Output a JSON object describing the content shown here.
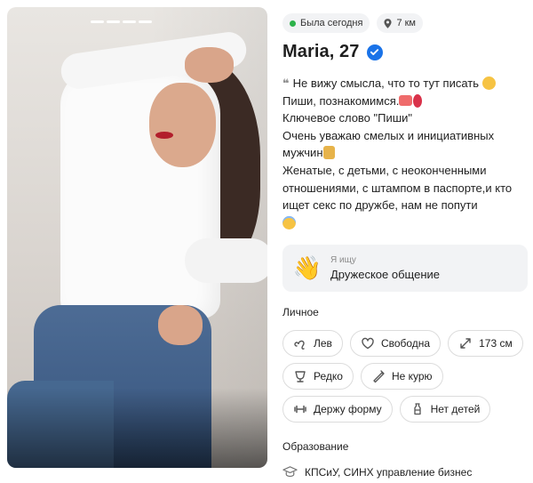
{
  "photo": {
    "story_bars": 4,
    "alt": "profile-photo"
  },
  "status": {
    "online_label": "Была сегодня",
    "distance_label": "7 км"
  },
  "profile": {
    "name_age": "Maria, 27",
    "verified": true
  },
  "bio": {
    "line1": "Не вижу смысла, что то тут писать",
    "line2": "Пиши, познакомимся.",
    "line3": "Ключевое слово \"Пиши\"",
    "line4": "Очень уважаю смелых и инициативных мужчин",
    "line5": "Женатые, с детьми, с неоконченными отношениями, с штампом в паспорте,и кто ищет секс по дружбе, нам не попути"
  },
  "seeking": {
    "label": "Я ищу",
    "value": "Дружеское общение"
  },
  "personal": {
    "title": "Личное",
    "tags": [
      {
        "icon": "leo-zodiac-icon",
        "label": "Лев"
      },
      {
        "icon": "heart-icon",
        "label": "Свободна"
      },
      {
        "icon": "height-icon",
        "label": "173 см"
      },
      {
        "icon": "drink-icon",
        "label": "Редко"
      },
      {
        "icon": "no-smoking-icon",
        "label": "Не курю"
      },
      {
        "icon": "dumbbell-icon",
        "label": "Держу форму"
      },
      {
        "icon": "bottle-icon",
        "label": "Нет детей"
      }
    ]
  },
  "education": {
    "title": "Образование",
    "value": "КПСиУ, СИНХ управление бизнес"
  },
  "colors": {
    "online": "#2db24a",
    "verified": "#1a73e8",
    "chip_bg": "#f2f3f5",
    "tag_border": "#dcdcdc"
  }
}
